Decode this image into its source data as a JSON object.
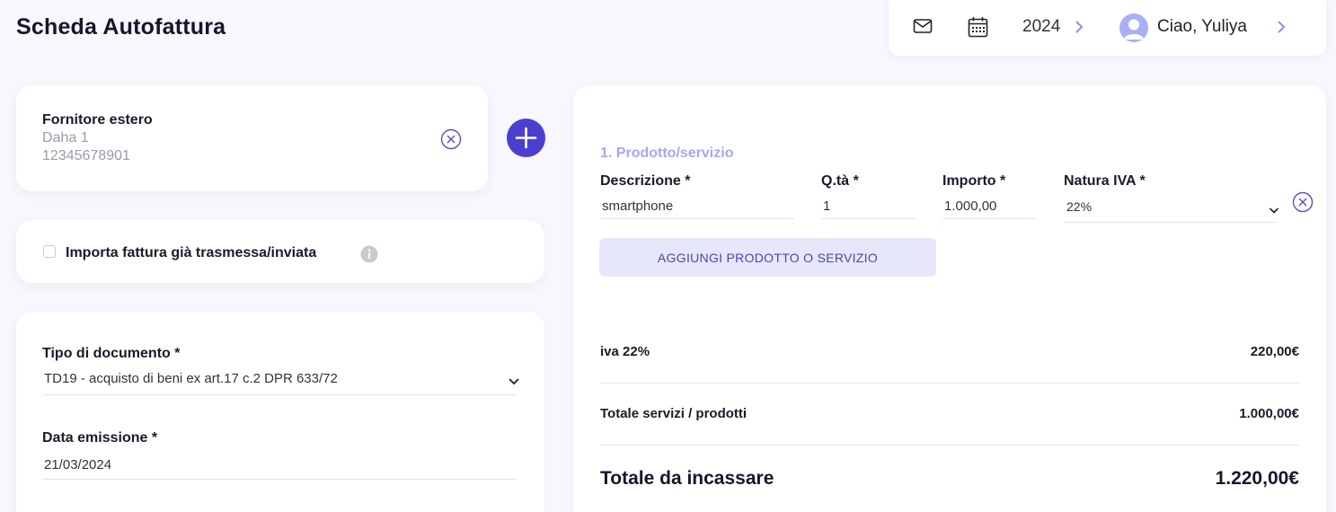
{
  "page": {
    "title": "Scheda Autofattura"
  },
  "topbar": {
    "year": "2024",
    "greeting": "Ciao, Yuliya",
    "icons": {
      "mail": "mail-icon",
      "calendar": "calendar-icon",
      "avatar": "user-avatar-icon"
    }
  },
  "supplier": {
    "title": "Fornitore estero",
    "name": "Daha 1",
    "vat": "12345678901"
  },
  "import": {
    "label": "Importa fattura già trasmessa/inviata",
    "checked": false
  },
  "document": {
    "type_label": "Tipo di documento *",
    "type_value": "TD19 - acquisto di beni ex art.17 c.2 DPR 633/72",
    "date_label": "Data emissione *",
    "date_value": "21/03/2024"
  },
  "products": {
    "section_title": "1. Prodotto/servizio",
    "columns": {
      "description": "Descrizione *",
      "quantity": "Q.tà *",
      "amount": "Importo *",
      "vat_nature": "Natura IVA *"
    },
    "rows": [
      {
        "description": "smartphone",
        "quantity": "1",
        "amount": "1.000,00",
        "vat_nature": "22%"
      }
    ],
    "add_button": "AGGIUNGI PRODOTTO O SERVIZIO"
  },
  "summary": {
    "vat_label": "iva 22%",
    "vat_value": "220,00€",
    "subtotal_label": "Totale servizi / prodotti",
    "subtotal_value": "1.000,00€",
    "total_label": "Totale da incassare",
    "total_value": "1.220,00€"
  },
  "colors": {
    "accent": "#4a3fce",
    "accent_light": "#e7e7fb",
    "section_title": "#a3a9ee",
    "background": "#f7f7fd"
  }
}
